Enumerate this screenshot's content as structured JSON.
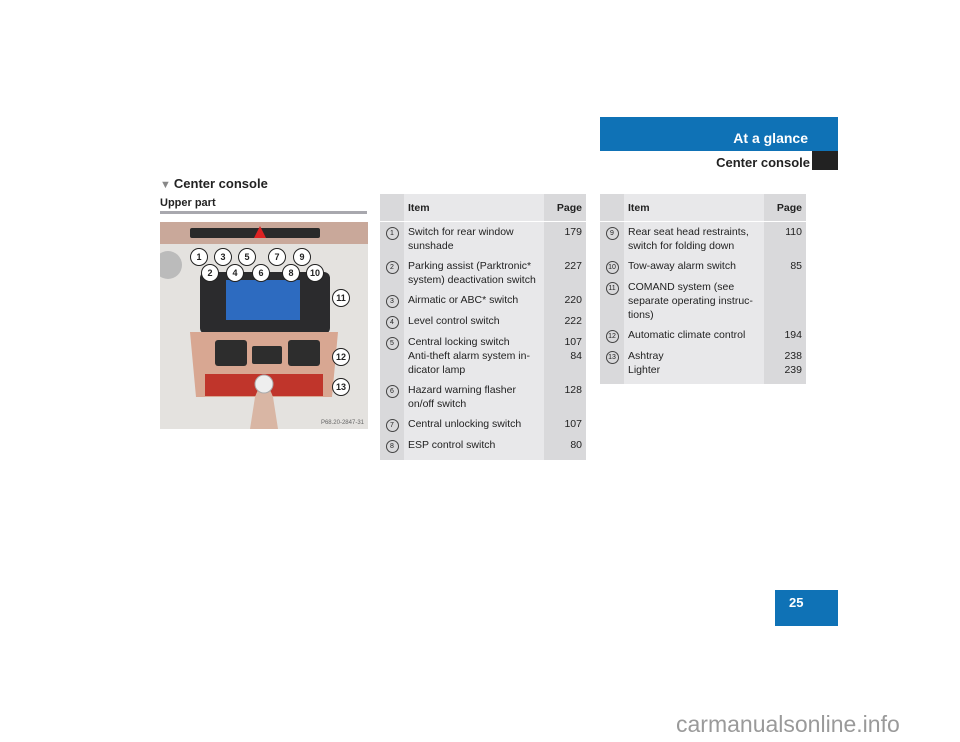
{
  "header": {
    "chapter": "At a glance",
    "section": "Center console"
  },
  "section_title": "Center console",
  "subsection_title": "Upper part",
  "figure": {
    "callouts": [
      "1",
      "2",
      "3",
      "4",
      "5",
      "6",
      "7",
      "8",
      "9",
      "10",
      "11",
      "12",
      "13"
    ],
    "caption": "P68.20-2847-31"
  },
  "table_left": {
    "headers": {
      "item": "Item",
      "page": "Page"
    },
    "rows": [
      {
        "num": "1",
        "item": "Switch for rear window sunshade",
        "page": "179"
      },
      {
        "num": "2",
        "item": "Parking assist (Parktronic* system) deactivation switch",
        "page": "227"
      },
      {
        "num": "3",
        "item": "Airmatic or ABC* switch",
        "page": "220"
      },
      {
        "num": "4",
        "item": "Level control switch",
        "page": "222"
      },
      {
        "num": "5",
        "item": "Central locking switch",
        "page": "107",
        "item2": "Anti-theft alarm system in-dicator lamp",
        "page2": "84"
      },
      {
        "num": "6",
        "item": "Hazard warning flasher on/off switch",
        "page": "128"
      },
      {
        "num": "7",
        "item": "Central unlocking switch",
        "page": "107"
      },
      {
        "num": "8",
        "item": "ESP control switch",
        "page": "80"
      }
    ]
  },
  "table_right": {
    "headers": {
      "item": "Item",
      "page": "Page"
    },
    "rows": [
      {
        "num": "9",
        "item": "Rear seat head restraints, switch for folding down",
        "page": "110"
      },
      {
        "num": "10",
        "item": "Tow-away alarm switch",
        "page": "85"
      },
      {
        "num": "11",
        "item": "COMAND system (see separate operating instruc-tions)",
        "page": ""
      },
      {
        "num": "12",
        "item": "Automatic climate control",
        "page": "194"
      },
      {
        "num": "13",
        "item": "Ashtray",
        "page": "238",
        "item2": "Lighter",
        "page2": "239"
      }
    ]
  },
  "page_number": "25",
  "watermark": "carmanualsonline.info",
  "colors": {
    "brand_blue": "#0f72b6",
    "table_dark": "#d9d9db",
    "table_light": "#e8e8ea"
  }
}
